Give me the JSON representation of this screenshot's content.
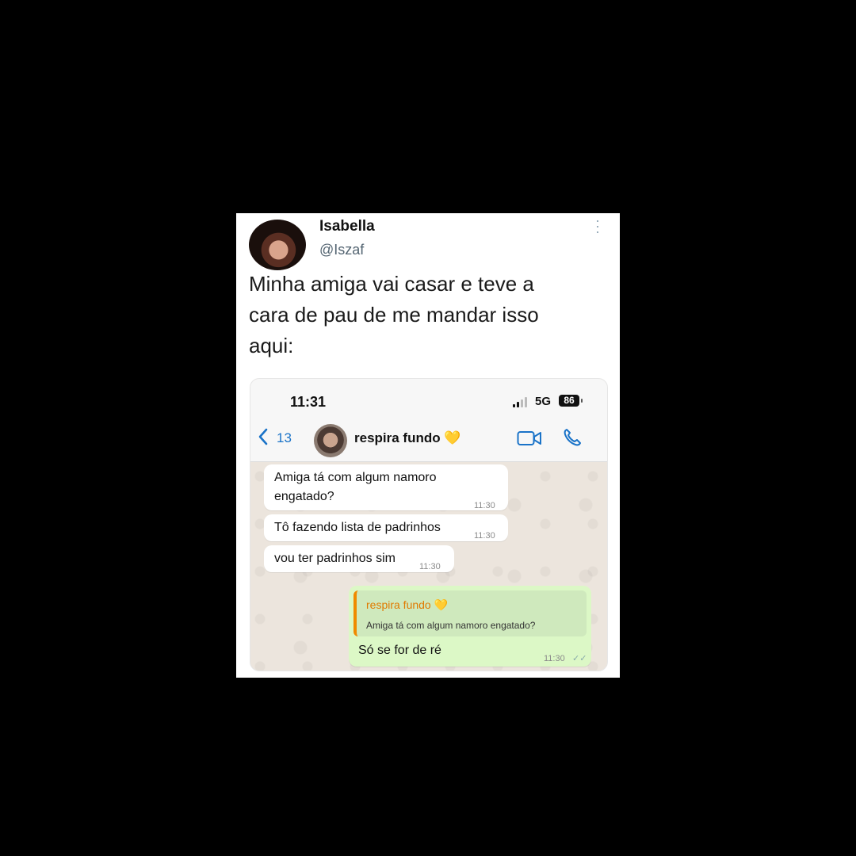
{
  "tweet": {
    "name": "Isabella",
    "handle": "@Iszaf",
    "more_icon": "kebab-icon",
    "text_lines": [
      "Minha amiga vai casar e teve a",
      "cara de pau de me mandar isso",
      "aqui:"
    ]
  },
  "screenshot": {
    "status": {
      "time": "11:31",
      "network": "5G",
      "battery": "86"
    },
    "header": {
      "back_count": "13",
      "contact_name": "respira fundo",
      "contact_emoji": "💛"
    },
    "messages": [
      {
        "text_lines": [
          "Amiga tá com algum namoro",
          "engatado?"
        ],
        "time": "11:30"
      },
      {
        "text": "Tô fazendo lista de padrinhos",
        "time": "11:30"
      },
      {
        "text": "vou ter padrinhos sim",
        "time": "11:30"
      }
    ],
    "reply": {
      "quote_name": "respira fundo",
      "quote_emoji": "💛",
      "quote_text": "Amiga tá com algum namoro engatado?",
      "text": "Só se for de ré",
      "time": "11:30",
      "ticks": "✓✓"
    }
  },
  "colors": {
    "accent_blue": "#1a73c8",
    "outgoing_bubble": "#dcf8c6",
    "quote_name": "#e07a00"
  }
}
